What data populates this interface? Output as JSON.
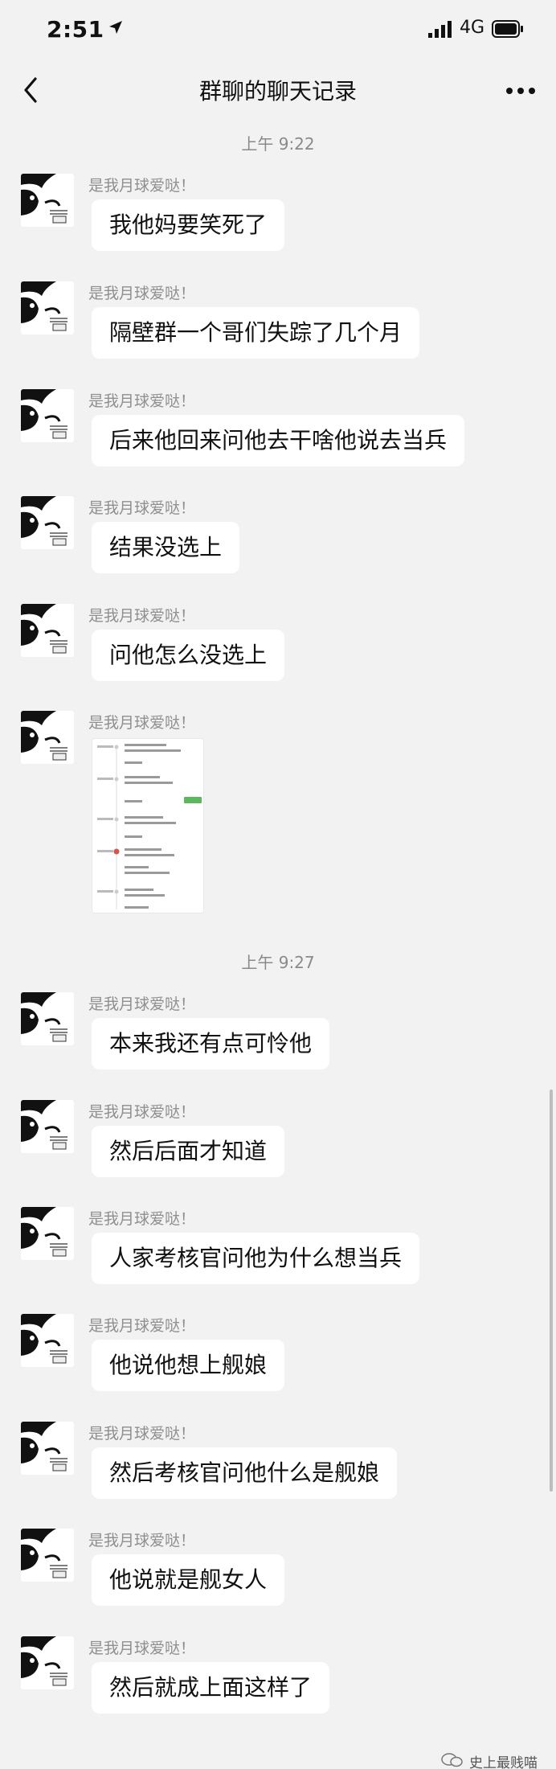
{
  "status_bar": {
    "time": "2:51",
    "network": "4G",
    "icons": [
      "location-arrow-icon",
      "signal-bars-icon",
      "battery-icon"
    ]
  },
  "nav": {
    "title": "群聊的聊天记录",
    "back_icon": "chevron-left-icon",
    "more_icon": "more-dots-icon"
  },
  "timestamps": [
    "上午 9:22",
    "上午 9:27"
  ],
  "messages": [
    {
      "sender": "是我月球爱哒！",
      "text": "我他妈要笑死了"
    },
    {
      "sender": "是我月球爱哒！",
      "text": "隔壁群一个哥们失踪了几个月"
    },
    {
      "sender": "是我月球爱哒！",
      "text": "后来他回来问他去干啥他说去当兵"
    },
    {
      "sender": "是我月球爱哒！",
      "text": "结果没选上"
    },
    {
      "sender": "是我月球爱哒！",
      "text": "问他怎么没选上"
    },
    {
      "sender": "是我月球爱哒！",
      "type": "image"
    },
    {
      "sender": "是我月球爱哒！",
      "text": "本来我还有点可怜他"
    },
    {
      "sender": "是我月球爱哒！",
      "text": "然后后面才知道"
    },
    {
      "sender": "是我月球爱哒！",
      "text": "人家考核官问他为什么想当兵"
    },
    {
      "sender": "是我月球爱哒！",
      "text": "他说他想上舰娘"
    },
    {
      "sender": "是我月球爱哒！",
      "text": "然后考核官问他什么是舰娘"
    },
    {
      "sender": "是我月球爱哒！",
      "text": "他说就是舰女人"
    },
    {
      "sender": "是我月球爱哒！",
      "text": "然后就成上面这样了"
    }
  ],
  "watermark": {
    "text": "史上最贱喵",
    "icon": "wechat-account-icon"
  }
}
